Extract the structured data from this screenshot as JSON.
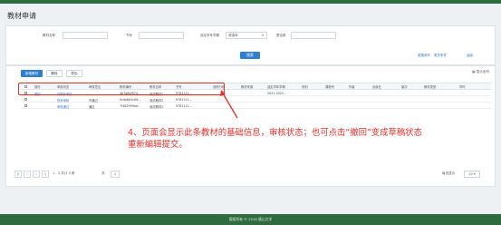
{
  "page": {
    "title": "教材申请"
  },
  "filters": [
    {
      "label": "教材名称",
      "value": ""
    },
    {
      "label": "书号",
      "value": ""
    },
    {
      "label": "选定学年学期",
      "value": "请选择"
    },
    {
      "label": "是否新",
      "value": ""
    }
  ],
  "search_label": "搜索",
  "right_links": [
    "重置条件",
    "更多条件",
    "高级"
  ],
  "toolbar": {
    "new_label": "新增教材",
    "delete_label": "删除",
    "export_label": "导出",
    "display_all_label": "显示全列"
  },
  "table": {
    "columns": [
      "操作",
      "审核状态",
      "审核意见",
      "教材编号",
      "教材名称",
      "书号",
      "选修分组",
      "教材来源",
      "选定学年学期",
      "系别",
      "课程号",
      "作者",
      "出版社",
      "版次",
      "教材类型",
      "学时"
    ],
    "rows": [
      {
        "action": "撤回",
        "status": "待院系审核",
        "opinion": "",
        "code": "4b7a8df974...",
        "name": "测试教材2",
        "isbn": "9781111...",
        "term": "2021-2022..."
      },
      {
        "action": "",
        "status": "院系审核",
        "opinion": "不通过",
        "code": "9cda8d5c06...",
        "name": "测试教材2",
        "isbn": "9781111...",
        "term": ""
      },
      {
        "action": "",
        "status": "审核通过",
        "opinion": "通过",
        "code": "7f482999ad...",
        "name": "测试教材2",
        "isbn": "9781111...",
        "term": ""
      }
    ]
  },
  "annotation": {
    "line1": "4、页面会显示此条教材的基础信息，审核状态；也可点击“撤回”变成草稿状态",
    "line2": "重新编辑提交。"
  },
  "pager": {
    "range": "1 - 3 共计 3 条",
    "page_size_prefix": "每页显示",
    "page_size": "10",
    "current": "1",
    "total_label": "共"
  },
  "footer": {
    "text": "版权所有 © 2018 唐山大学"
  }
}
